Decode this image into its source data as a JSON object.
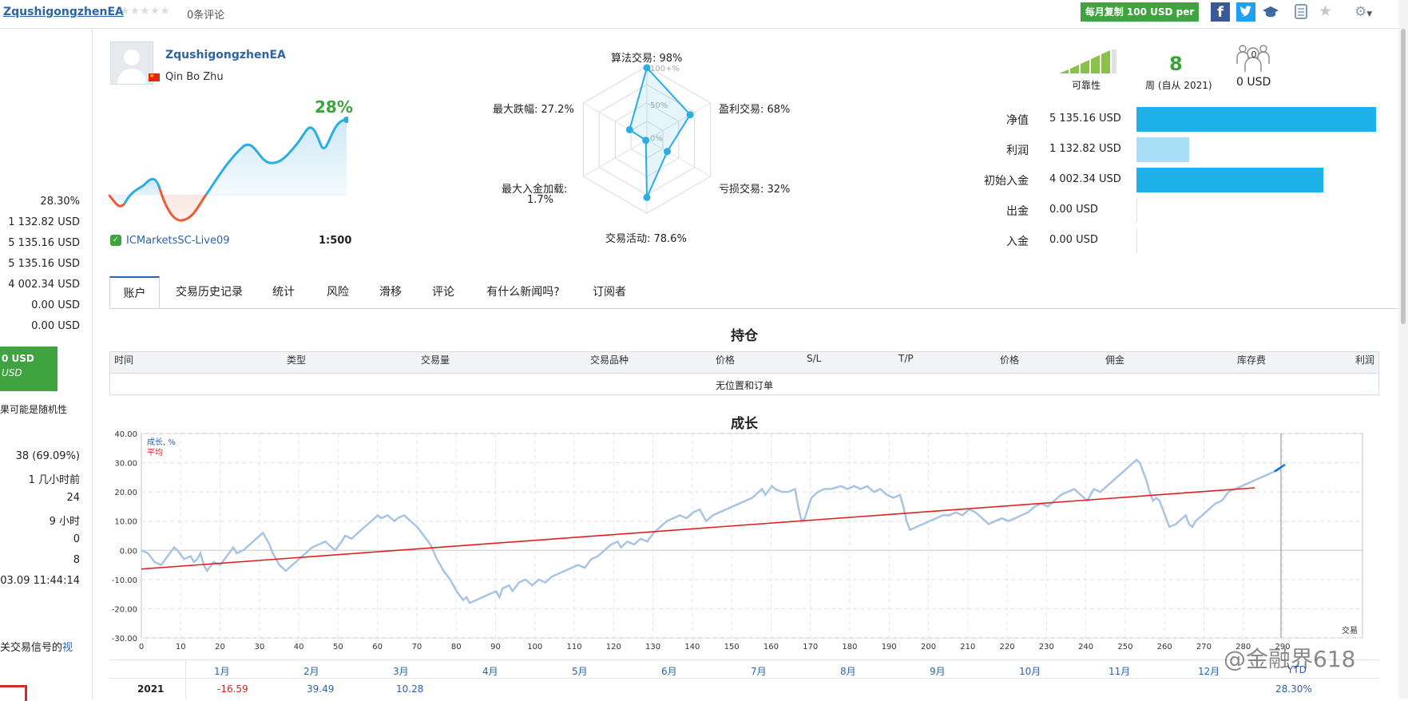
{
  "header": {
    "ea_name": "ZqushigongzhenEA",
    "reviews": "0条评论",
    "subscribe_button": "每月复制 100 USD per"
  },
  "profile": {
    "name": "ZqushigongzhenEA",
    "author": "Qin Bo Zhu",
    "growth_pct": "28%",
    "server": "ICMarketsSC-Live09",
    "leverage": "1:500"
  },
  "radar": {
    "labels": {
      "algo": "算法交易: 98%",
      "profit": "盈利交易: 68%",
      "loss": "亏损交易: 32%",
      "activity": "交易活动: 78.6%",
      "deposit_load": "最大入金加载:",
      "deposit_load_val": "1.7%",
      "drawdown": "最大跌幅: 27.2%"
    },
    "ring_labels": [
      "100+%",
      "50%",
      "0%"
    ],
    "values": {
      "algo": 98,
      "profit": 68,
      "loss": 32,
      "activity": 78.6,
      "deposit_load": 1.7,
      "drawdown": 27.2
    }
  },
  "stats_top": {
    "reliability_label": "可靠性",
    "weeks_value": "8",
    "weeks_label": "周 (自从 2021)",
    "subscribers_count": "0",
    "subscribers_value": "0 USD"
  },
  "balance_bars": [
    {
      "label": "净值",
      "value": "5 135.16 USD",
      "amount": 5135.16,
      "color": "#1fb2ea"
    },
    {
      "label": "利润",
      "value": "1 132.82 USD",
      "amount": 1132.82,
      "color": "#a8def6"
    },
    {
      "label": "初始入金",
      "value": "4 002.34 USD",
      "amount": 4002.34,
      "color": "#1fb2ea"
    },
    {
      "label": "出金",
      "value": "0.00 USD",
      "amount": 0,
      "color": "#1fb2ea"
    },
    {
      "label": "入金",
      "value": "0.00 USD",
      "amount": 0,
      "color": "#1fb2ea"
    }
  ],
  "left_panel": {
    "values": [
      "28.30%",
      "1 132.82 USD",
      "5 135.16 USD",
      "5 135.16 USD",
      "4 002.34 USD",
      "0.00 USD",
      "0.00 USD"
    ],
    "green_line1": "0 USD",
    "green_line2": "USD",
    "note": "果可能是随机性",
    "values2": [
      "38 (69.09%)",
      "1 几小时前",
      "24",
      "9 小时",
      "0",
      "8",
      ".03.09 11:44:14"
    ],
    "footer_text": "关交易信号的",
    "footer_link": "视"
  },
  "tabs": [
    "账户",
    "交易历史记录",
    "统计",
    "风险",
    "滑移",
    "评论",
    "有什么新闻吗?",
    "订阅者"
  ],
  "positions": {
    "title": "持仓",
    "columns": [
      "时间",
      "类型",
      "交易量",
      "交易品种",
      "价格",
      "S/L",
      "T/P",
      "价格",
      "佣金",
      "库存费",
      "利润"
    ],
    "empty": "无位置和订单"
  },
  "growth": {
    "title": "成长",
    "legend_growth": "成长, %",
    "legend_avg": "平均",
    "x_axis_label": "交易"
  },
  "months_table": {
    "months": [
      "1月",
      "2月",
      "3月",
      "4月",
      "5月",
      "6月",
      "7月",
      "8月",
      "9月",
      "10月",
      "11月",
      "12月",
      "YTD"
    ],
    "year": "2021",
    "values": [
      "-16.59",
      "39.49",
      "10.28"
    ],
    "ytd": "28.30%"
  },
  "watermark": "@金融界618",
  "chart_data": {
    "type": "line",
    "title": "成长",
    "xlabel": "交易",
    "ylabel": "",
    "xlim": [
      0,
      190
    ],
    "ylim": [
      -30,
      40
    ],
    "x_ticks": [
      0,
      10,
      20,
      30,
      40,
      50,
      60,
      70,
      80,
      90,
      100,
      110,
      120,
      130,
      140,
      150,
      160,
      170,
      180,
      190,
      200,
      210,
      220,
      230,
      240,
      250,
      260,
      270,
      280,
      290
    ],
    "y_ticks": [
      -30,
      -20,
      -10,
      0,
      10,
      20,
      30,
      40
    ],
    "series": [
      {
        "name": "成长, %",
        "color": "#a9c4e2",
        "points": [
          [
            0,
            0
          ],
          [
            2,
            -1
          ],
          [
            4,
            -4
          ],
          [
            6,
            -5
          ],
          [
            8,
            -2
          ],
          [
            10,
            1
          ],
          [
            11,
            0
          ],
          [
            13,
            -3
          ],
          [
            15,
            -2
          ],
          [
            16,
            -4
          ],
          [
            17,
            -3
          ],
          [
            18,
            -1
          ],
          [
            19,
            -5
          ],
          [
            20,
            -7
          ],
          [
            22,
            -4
          ],
          [
            24,
            -5
          ],
          [
            26,
            -2
          ],
          [
            28,
            1
          ],
          [
            29,
            -1
          ],
          [
            31,
            0
          ],
          [
            33,
            2
          ],
          [
            35,
            4
          ],
          [
            37,
            6
          ],
          [
            38,
            4
          ],
          [
            39,
            2
          ],
          [
            40,
            -1
          ],
          [
            42,
            -5
          ],
          [
            44,
            -7
          ],
          [
            46,
            -5
          ],
          [
            48,
            -3
          ],
          [
            50,
            -1
          ],
          [
            52,
            1
          ],
          [
            54,
            2
          ],
          [
            56,
            3
          ],
          [
            58,
            1
          ],
          [
            59,
            0
          ],
          [
            61,
            3
          ],
          [
            62,
            5
          ],
          [
            64,
            4
          ],
          [
            66,
            6
          ],
          [
            68,
            8
          ],
          [
            70,
            10
          ],
          [
            72,
            12
          ],
          [
            73,
            11
          ],
          [
            75,
            12
          ],
          [
            77,
            10
          ],
          [
            78,
            11
          ],
          [
            80,
            12
          ],
          [
            82,
            10
          ],
          [
            84,
            8
          ],
          [
            86,
            5
          ],
          [
            88,
            2
          ],
          [
            90,
            -3
          ],
          [
            92,
            -7
          ],
          [
            94,
            -10
          ],
          [
            96,
            -14
          ],
          [
            98,
            -17
          ],
          [
            99,
            -16
          ],
          [
            100,
            -18
          ],
          [
            102,
            -17
          ],
          [
            104,
            -16
          ],
          [
            106,
            -15
          ],
          [
            108,
            -14
          ],
          [
            109,
            -16
          ],
          [
            110,
            -13
          ],
          [
            112,
            -12
          ],
          [
            113,
            -14
          ],
          [
            115,
            -11
          ],
          [
            117,
            -10
          ],
          [
            119,
            -12
          ],
          [
            121,
            -10
          ],
          [
            123,
            -11
          ],
          [
            125,
            -9
          ],
          [
            127,
            -8
          ],
          [
            129,
            -7
          ],
          [
            131,
            -6
          ],
          [
            133,
            -5
          ],
          [
            135,
            -6
          ],
          [
            137,
            -3
          ],
          [
            139,
            -2
          ],
          [
            141,
            0
          ],
          [
            143,
            2
          ],
          [
            145,
            3
          ],
          [
            146,
            1
          ],
          [
            148,
            3
          ],
          [
            150,
            2
          ],
          [
            152,
            4
          ],
          [
            154,
            3
          ],
          [
            156,
            6
          ],
          [
            158,
            8
          ],
          [
            160,
            10
          ],
          [
            162,
            11
          ],
          [
            164,
            12
          ],
          [
            166,
            11
          ],
          [
            168,
            13
          ],
          [
            170,
            14
          ],
          [
            172,
            10
          ],
          [
            174,
            12
          ],
          [
            176,
            13
          ],
          [
            178,
            14
          ],
          [
            180,
            15
          ],
          [
            182,
            16
          ],
          [
            184,
            17
          ],
          [
            186,
            18
          ],
          [
            188,
            20
          ],
          [
            189,
            21
          ],
          [
            190,
            19
          ],
          [
            192,
            22
          ],
          [
            193,
            21
          ],
          [
            195,
            20
          ],
          [
            197,
            20
          ],
          [
            199,
            21
          ],
          [
            200,
            15
          ],
          [
            201,
            10
          ],
          [
            202,
            11
          ],
          [
            204,
            18
          ],
          [
            206,
            20
          ],
          [
            208,
            21
          ],
          [
            210,
            21
          ],
          [
            213,
            22
          ],
          [
            215,
            21
          ],
          [
            217,
            22
          ],
          [
            219,
            21
          ],
          [
            221,
            22
          ],
          [
            223,
            20
          ],
          [
            225,
            21
          ],
          [
            227,
            19
          ],
          [
            229,
            18
          ],
          [
            231,
            19
          ],
          [
            232,
            15
          ],
          [
            233,
            10
          ],
          [
            234,
            7
          ],
          [
            236,
            8
          ],
          [
            238,
            9
          ],
          [
            240,
            10
          ],
          [
            242,
            11
          ],
          [
            244,
            12
          ],
          [
            246,
            12
          ],
          [
            248,
            13
          ],
          [
            250,
            12
          ],
          [
            252,
            14
          ],
          [
            254,
            13
          ],
          [
            256,
            11
          ],
          [
            258,
            9
          ],
          [
            260,
            10
          ],
          [
            262,
            11
          ],
          [
            264,
            10
          ],
          [
            266,
            11
          ],
          [
            268,
            12
          ],
          [
            270,
            13
          ],
          [
            272,
            15
          ],
          [
            274,
            16
          ],
          [
            276,
            15
          ],
          [
            278,
            17
          ],
          [
            280,
            19
          ],
          [
            282,
            20
          ],
          [
            284,
            21
          ],
          [
            286,
            19
          ],
          [
            288,
            17
          ],
          [
            290,
            21
          ],
          [
            292,
            20
          ],
          [
            294,
            22
          ],
          [
            296,
            24
          ],
          [
            298,
            26
          ],
          [
            300,
            28
          ],
          [
            302,
            30
          ],
          [
            303,
            31
          ],
          [
            304,
            30
          ],
          [
            305,
            27
          ],
          [
            306,
            24
          ],
          [
            307,
            20
          ],
          [
            308,
            17
          ],
          [
            309,
            18
          ],
          [
            310,
            17
          ],
          [
            311,
            14
          ],
          [
            312,
            11
          ],
          [
            313,
            8
          ],
          [
            315,
            9
          ],
          [
            317,
            11
          ],
          [
            318,
            12
          ],
          [
            319,
            9
          ],
          [
            320,
            8
          ],
          [
            321,
            10
          ],
          [
            323,
            12
          ],
          [
            325,
            14
          ],
          [
            327,
            16
          ],
          [
            329,
            17
          ],
          [
            331,
            20
          ],
          [
            333,
            21
          ],
          [
            335,
            22
          ],
          [
            337,
            23
          ],
          [
            339,
            24
          ],
          [
            341,
            25
          ],
          [
            343,
            26
          ],
          [
            345,
            27
          ],
          [
            347,
            28
          ]
        ]
      },
      {
        "name": "平均",
        "color": "#e02020",
        "points": [
          [
            0,
            -6.4
          ],
          [
            339,
            21.4
          ]
        ]
      }
    ]
  }
}
